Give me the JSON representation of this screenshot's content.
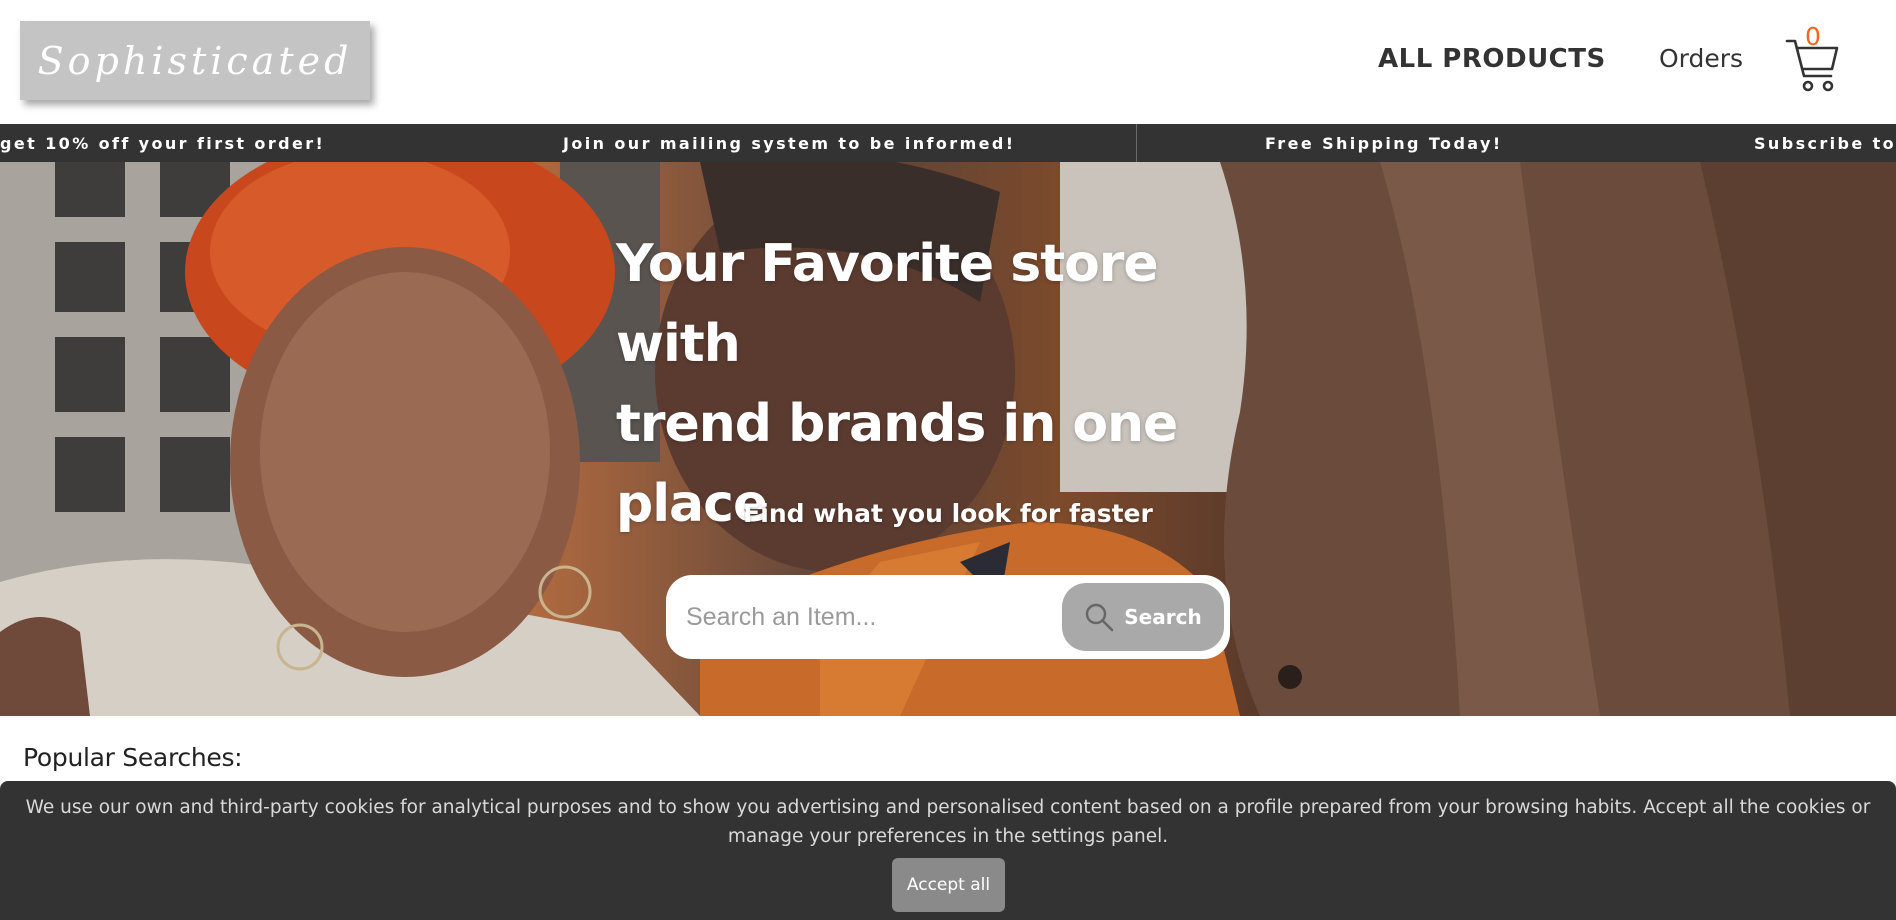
{
  "header": {
    "logo_text": "Sophisticated",
    "nav": {
      "all_products": "ALL PRODUCTS",
      "orders": "Orders"
    },
    "cart": {
      "icon": "cart-icon",
      "count": "0"
    }
  },
  "ticker": {
    "items": [
      "get 10% off your first order!",
      "Join our mailing system to be informed!",
      "Free Shipping Today!",
      "Subscribe to"
    ]
  },
  "hero": {
    "title_lines": [
      "Your Favorite store with",
      "trend brands in one",
      "place"
    ],
    "subtitle": "Find what you look for faster",
    "search": {
      "placeholder": "Search an Item...",
      "value": "",
      "button_label": "Search",
      "button_icon": "search-icon"
    }
  },
  "popular": {
    "heading": "Popular Searches:"
  },
  "cookie_banner": {
    "text": "We use our own and third-party cookies for analytical purposes and to show you advertising and personalised content based on a profile prepared from your browsing habits. Accept all the cookies or manage your preferences in the settings panel.",
    "accept_label": "Accept all"
  },
  "colors": {
    "accent_orange": "#f26522",
    "ticker_bg": "#333333",
    "logo_bg": "#c4c4c4",
    "search_button_bg": "#a9a9a9",
    "cookie_bg": "#333333"
  }
}
